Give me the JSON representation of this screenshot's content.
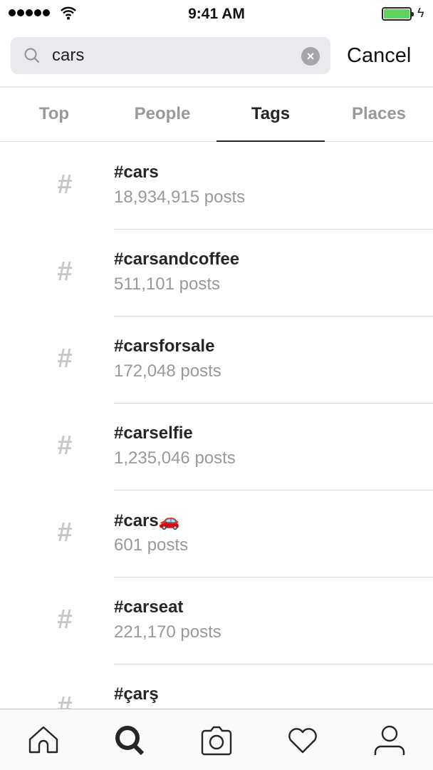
{
  "status_bar": {
    "time": "9:41 AM",
    "battery_color": "#5fd35c",
    "battery_level": 1.0
  },
  "search": {
    "query": "cars",
    "cancel_label": "Cancel"
  },
  "tabs": [
    {
      "label": "Top"
    },
    {
      "label": "People"
    },
    {
      "label": "Tags",
      "active": true
    },
    {
      "label": "Places"
    }
  ],
  "results": [
    {
      "tag": "#cars",
      "posts": "18,934,915 posts"
    },
    {
      "tag": "#carsandcoffee",
      "posts": "511,101 posts"
    },
    {
      "tag": "#carsforsale",
      "posts": "172,048 posts"
    },
    {
      "tag": "#carselfie",
      "posts": "1,235,046 posts"
    },
    {
      "tag": "#cars🚗",
      "posts": "601 posts"
    },
    {
      "tag": "#carseat",
      "posts": "221,170 posts"
    },
    {
      "tag": "#çarş",
      "posts": ""
    }
  ],
  "hash_symbol": "#",
  "bottom_nav": [
    "home-icon",
    "search-icon",
    "camera-icon",
    "heart-icon",
    "profile-icon"
  ]
}
